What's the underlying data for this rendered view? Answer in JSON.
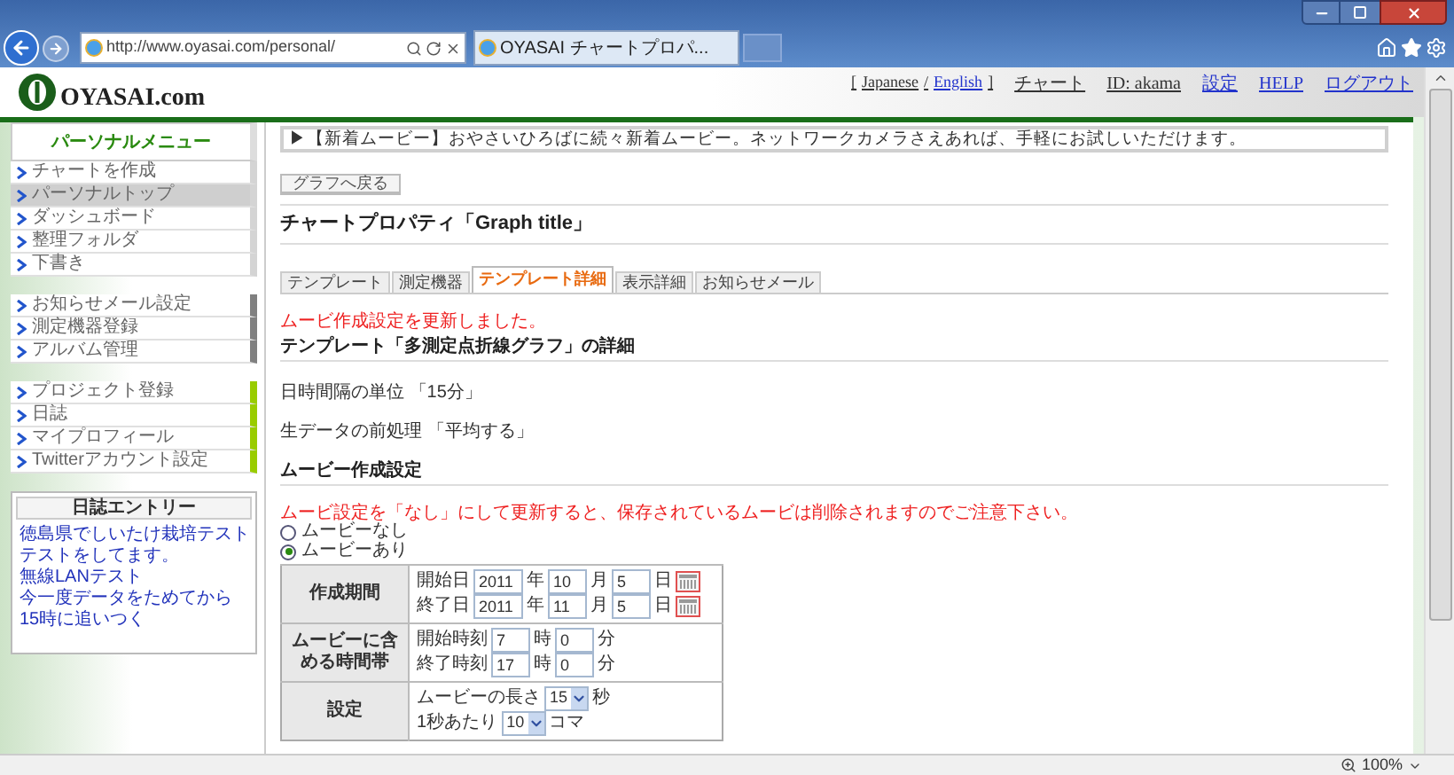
{
  "browser": {
    "url": "http://www.oyasai.com/personal/",
    "tab_title": "OYASAI チャートプロパ...",
    "zoom": "100%"
  },
  "header": {
    "logo": "OYASAI.com",
    "language": {
      "prefix": "[",
      "options": [
        {
          "label": "Japanese",
          "selected": true
        },
        {
          "label": "English",
          "selected": false
        }
      ],
      "separator": "/",
      "suffix": "]"
    },
    "links": [
      {
        "label": "チャート",
        "kind": "text"
      },
      {
        "label": "ID: akama",
        "kind": "text"
      },
      {
        "label": "設定",
        "kind": "link"
      },
      {
        "label": "HELP",
        "kind": "link"
      },
      {
        "label": "ログアウト",
        "kind": "link"
      }
    ]
  },
  "sidebar": {
    "title": "パーソナルメニュー",
    "groups": [
      {
        "color": "#d4d4d4",
        "items": [
          {
            "label": "チャートを作成",
            "selected": false
          },
          {
            "label": "パーソナルトップ",
            "selected": true
          },
          {
            "label": "ダッシュボード",
            "selected": false
          },
          {
            "label": "整理フォルダ",
            "selected": false
          },
          {
            "label": "下書き",
            "selected": false
          }
        ]
      },
      {
        "color": "#808080",
        "items": [
          {
            "label": "お知らせメール設定",
            "selected": false
          },
          {
            "label": "測定機器登録",
            "selected": false
          },
          {
            "label": "アルバム管理",
            "selected": false
          }
        ]
      },
      {
        "color": "#99cc00",
        "items": [
          {
            "label": "プロジェクト登録",
            "selected": false
          },
          {
            "label": "日誌",
            "selected": false
          },
          {
            "label": "マイプロフィール",
            "selected": false
          },
          {
            "label": "Twitterアカウント設定",
            "selected": false
          }
        ]
      }
    ],
    "entries": {
      "title": "日誌エントリー",
      "items": [
        "徳島県でしいたけ栽培テスト",
        "テストをしてます。",
        "無線LANテスト",
        "今一度データをためてから",
        "15時に追いつく"
      ]
    }
  },
  "main": {
    "notice": "▶【新着ムービー】おやさいひろばに続々新着ムービー。ネットワークカメラさえあれば、手軽にお試しいただけます。",
    "back_button": "グラフへ戻る",
    "title": "チャートプロパティ「Graph title」",
    "tabs": [
      {
        "label": "テンプレート",
        "selected": false
      },
      {
        "label": "測定機器",
        "selected": false
      },
      {
        "label": "テンプレート詳細",
        "selected": true
      },
      {
        "label": "表示詳細",
        "selected": false
      },
      {
        "label": "お知らせメール",
        "selected": false
      }
    ],
    "message": "ムービ作成設定を更新しました。",
    "template_heading": "テンプレート「多測定点折線グラフ」の詳細",
    "interval": "日時間隔の単位 「15分」",
    "preprocess": "生データの前処理 「平均する」",
    "movie_heading": "ムービー作成設定",
    "warning": "ムービ設定を「なし」にして更新すると、保存されているムービは削除されますのでご注意下さい。",
    "radios": [
      {
        "label": "ムービーなし",
        "selected": false
      },
      {
        "label": "ムービーあり",
        "selected": true
      }
    ],
    "form": [
      {
        "header": "作成期間",
        "lines": [
          {
            "label": "開始日",
            "calendar": true,
            "fields": [
              {
                "kind": "input",
                "value": "2011",
                "unit": "年"
              },
              {
                "kind": "input",
                "value": "10",
                "unit": "月"
              },
              {
                "kind": "input",
                "value": "5",
                "unit": "日"
              }
            ]
          },
          {
            "label": "終了日",
            "calendar": true,
            "fields": [
              {
                "kind": "input",
                "value": "2011",
                "unit": "年"
              },
              {
                "kind": "input",
                "value": "11",
                "unit": "月"
              },
              {
                "kind": "input",
                "value": "5",
                "unit": "日"
              }
            ]
          }
        ]
      },
      {
        "header": "ムービーに含める時間帯",
        "lines": [
          {
            "label": "開始時刻",
            "calendar": false,
            "fields": [
              {
                "kind": "input",
                "value": "7",
                "unit": "時"
              },
              {
                "kind": "input",
                "value": "0",
                "unit": "分"
              }
            ]
          },
          {
            "label": "終了時刻",
            "calendar": false,
            "fields": [
              {
                "kind": "input",
                "value": "17",
                "unit": "時"
              },
              {
                "kind": "input",
                "value": "0",
                "unit": "分"
              }
            ]
          }
        ]
      },
      {
        "header": "設定",
        "lines": [
          {
            "label": "ムービーの長さ",
            "calendar": false,
            "fields": [
              {
                "kind": "select",
                "value": "15",
                "unit": "秒"
              }
            ]
          },
          {
            "label": "1秒あたり",
            "calendar": false,
            "fields": [
              {
                "kind": "select",
                "value": "10",
                "unit": "コマ"
              }
            ]
          }
        ]
      }
    ]
  }
}
